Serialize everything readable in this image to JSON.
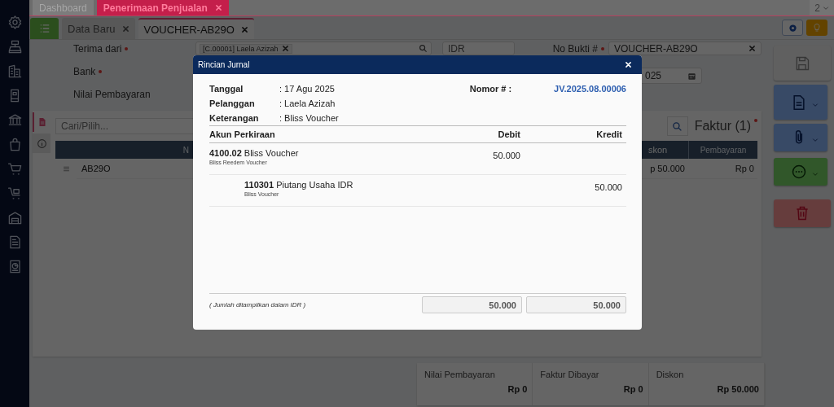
{
  "top_tabs": [
    {
      "label": "Dashboard",
      "selected": false,
      "closable": false
    },
    {
      "label": "Penerimaan Penjualan",
      "selected": true,
      "closable": true
    }
  ],
  "window_count": "2",
  "doc_tabs": [
    {
      "label": "Data Baru",
      "selected": false
    },
    {
      "label": "VOUCHER-AB29O",
      "selected": true
    }
  ],
  "form": {
    "terima_dari": {
      "label": "Terima dari",
      "required": true,
      "chip": "[C.00001] Laela Azizah"
    },
    "bank": {
      "label": "Bank",
      "required": true
    },
    "nilai_pembayaran": {
      "label": "Nilai Pembayaran"
    },
    "currency": {
      "value": "IDR"
    },
    "no_bukti": {
      "label": "No Bukti #",
      "required": true,
      "value": "VOUCHER-AB29O"
    },
    "date": {
      "value": "025"
    }
  },
  "faktur_panel": {
    "search_placeholder": "Cari/Pilih...",
    "title": "Faktur (1)",
    "required": true,
    "columns": [
      "N",
      "skon",
      "Pembayaran"
    ],
    "rows": [
      {
        "cells": [
          "AB29O",
          "p 50.000",
          "Rp 0"
        ]
      }
    ]
  },
  "summary": [
    {
      "label": "Nilai Pembayaran",
      "value": "Rp 0"
    },
    {
      "label": "Faktur Dibayar",
      "value": "Rp 0"
    },
    {
      "label": "Diskon",
      "value": "Rp 50.000"
    }
  ],
  "modal": {
    "title": "Rincian Jurnal",
    "info": [
      {
        "label": "Tanggal",
        "value": ": 17 Agu 2025"
      },
      {
        "label": "Pelanggan",
        "value": ": Laela Azizah"
      },
      {
        "label": "Keterangan",
        "value": ": Bliss Voucher"
      }
    ],
    "nomor": {
      "label": "Nomor # :",
      "value": "JV.2025.08.00006"
    },
    "columns": [
      "Akun Perkiraan",
      "Debit",
      "Kredit"
    ],
    "entries": [
      {
        "account": "**4100.02** Bliss Voucher",
        "note": "Bliss Reedem Voucher",
        "debit": "50.000",
        "indented": false
      },
      {
        "account": "**110301** Piutang Usaha IDR",
        "note": "Bliss Voucher",
        "kredit": "50.000",
        "indented": true
      }
    ],
    "footnote": "( Jumlah ditampilkan dalam IDR )",
    "totals": [
      "50.000",
      "50.000"
    ]
  }
}
